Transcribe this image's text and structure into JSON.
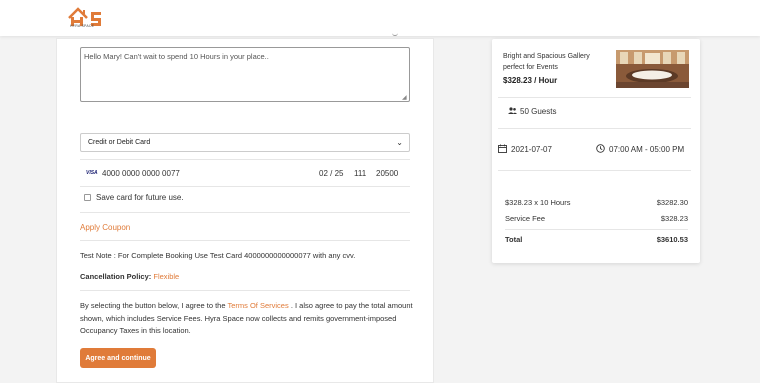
{
  "header": {
    "logo_text": "HYRA SPACE",
    "logo_icon": "house-hs-logo"
  },
  "booking": {
    "message": "Hello Mary! Can't wait to spend 10 Hours in your place..",
    "payment_method": "Credit or Debit Card",
    "card": {
      "brand": "VISA",
      "number": "4000 0000 0000 0077",
      "expiry": "02 / 25",
      "cvv": "111",
      "zip": "20500"
    },
    "save_card_label": "Save card for future use.",
    "apply_coupon": "Apply Coupon",
    "test_note": "Test Note : For Complete Booking Use Test Card 4000000000000077 with any cvv.",
    "cancellation_label": "Cancellation Policy:",
    "cancellation_value": "Flexible",
    "agree_prefix": "By selecting the button below, I agree to the",
    "terms_link": "Terms Of Services",
    "agree_suffix": ". I also agree to pay the total amount shown, which includes Service Fees. Hyra Space now collects and remits government-imposed Occupancy Taxes in this location.",
    "agree_button": "Agree and continue"
  },
  "summary": {
    "title": "Bright and Spacious Gallery perfect for Events",
    "price": "$328.23 / Hour",
    "guests": "50 Guests",
    "date": "2021-07-07",
    "time": "07:00 AM - 05:00 PM",
    "rows": [
      {
        "label": "$328.23 x 10 Hours",
        "value": "$3282.30"
      },
      {
        "label": "Service Fee",
        "value": "$328.23"
      },
      {
        "label": "Total",
        "value": "$3610.53"
      }
    ]
  },
  "colors": {
    "accent": "#e07b39",
    "background": "#f3f3f3"
  }
}
